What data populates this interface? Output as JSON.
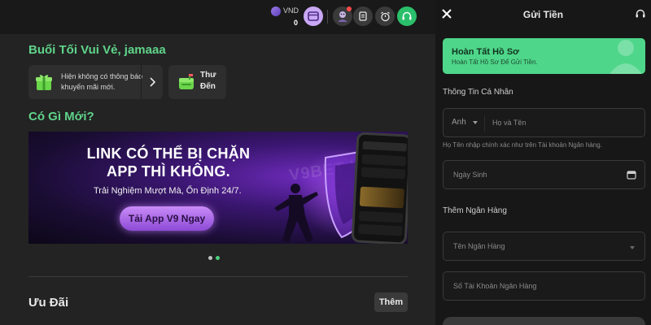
{
  "topbar": {
    "currency": "VND",
    "balance": "0"
  },
  "home": {
    "greeting": "Buổi Tối Vui Vẻ, jamaaa",
    "promo_message": "Hiện không có thông báo khuyến mãi mới.",
    "mailbox_label": "Thư Đến",
    "whats_new_title": "Có Gì Mới?",
    "banner": {
      "headline": "LINK CÓ THỂ BỊ CHẶN APP THÌ KHÔNG.",
      "subline": "Trải Nghiệm Mượt Mà, Ổn Định 24/7.",
      "cta": "Tải App V9 Ngay",
      "watermark": "V9BET V9"
    },
    "carousel": {
      "total": 2,
      "active_index": 2
    },
    "offers_title": "Ưu Đãi",
    "more_button": "Thêm"
  },
  "deposit_panel": {
    "title": "Gửi Tiền",
    "profile_card": {
      "title": "Hoàn Tất Hồ Sơ",
      "subtitle": "Hoàn Tất Hồ Sơ Để Gửi Tiền."
    },
    "personal_info_label": "Thông Tin Cá Nhân",
    "title_select_value": "Anh",
    "fullname_placeholder": "Họ và Tên",
    "name_hint": "Họ Tên nhập chính xác như trên Tài khoản Ngân hàng.",
    "dob_placeholder": "Ngày Sinh",
    "add_bank_label": "Thêm Ngân Hàng",
    "bank_name_placeholder": "Tên Ngân Hàng",
    "account_number_placeholder": "Số Tài Khoản Ngân Hàng"
  },
  "colors": {
    "accent_green": "#4ed68a",
    "heading_green": "#5fd48a",
    "banner_purple": "#6f2bbd",
    "cta_purple": "#c98cf7",
    "support_green": "#2bbf6b"
  },
  "icons": [
    "crypto-coin-icon",
    "wallet-icon",
    "avatar-icon",
    "document-icon",
    "alarm-icon",
    "headset-icon",
    "gift-icon",
    "chevron-right-icon",
    "mailbox-icon",
    "close-icon",
    "calendar-icon",
    "chevron-down-icon"
  ]
}
